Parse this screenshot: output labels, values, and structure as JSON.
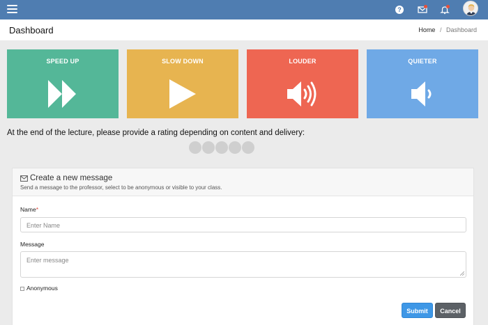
{
  "colors": {
    "topbar": "#4f7db1",
    "speed_up": "#54b798",
    "slow_down": "#e7b450",
    "louder": "#ee6652",
    "quieter": "#6fa9e6",
    "submit": "#3e97e6",
    "cancel": "#5c6166"
  },
  "topbar": {
    "menu_icon": "hamburger-icon",
    "help_icon": "help-icon",
    "help_glyph": "?",
    "mail_icon": "mail-icon",
    "bell_icon": "bell-icon"
  },
  "header": {
    "title": "Dashboard",
    "breadcrumb": {
      "home": "Home",
      "separator": "/",
      "current": "Dashboard"
    }
  },
  "tiles": [
    {
      "label": "SPEED UP",
      "icon": "fast-forward-icon"
    },
    {
      "label": "SLOW DOWN",
      "icon": "play-icon"
    },
    {
      "label": "LOUDER",
      "icon": "volume-up-icon"
    },
    {
      "label": "QUIETER",
      "icon": "volume-down-icon"
    }
  ],
  "rating": {
    "prompt": "At the end of the lecture, please provide a rating depending on content and delivery:",
    "max": 5,
    "selected": 0
  },
  "message_form": {
    "title": "Create a new message",
    "subtitle": "Send a message to the professor, select to be anonymous or visible to your class.",
    "name_label": "Name",
    "required_marker": "*",
    "name_placeholder": "Enter Name",
    "message_label": "Message",
    "message_placeholder": "Enter message",
    "anonymous_label": "Anonymous",
    "anonymous_checked": false,
    "submit_label": "Submit",
    "cancel_label": "Cancel"
  }
}
